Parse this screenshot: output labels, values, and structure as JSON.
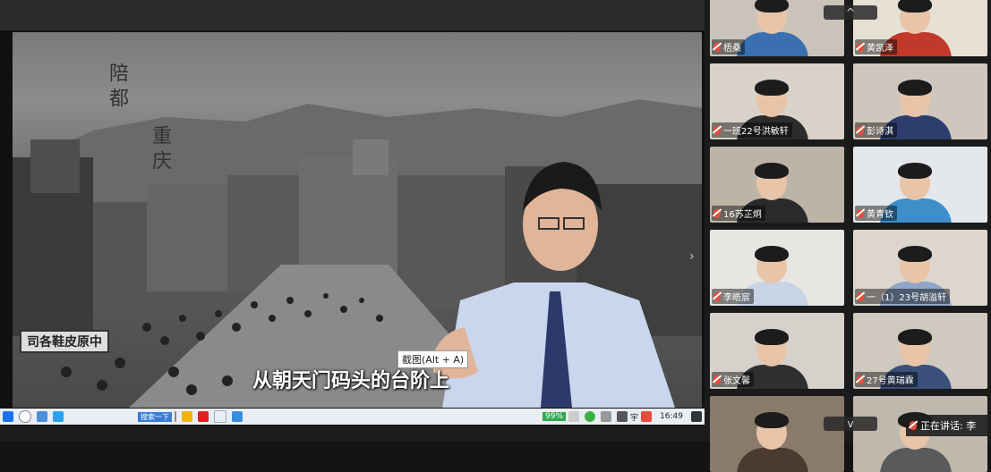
{
  "video": {
    "vertical_text_1": "陪都",
    "vertical_text_2": "重庆",
    "shop_sign": "司各鞋皮原中",
    "subtitle": "从朝天门码头的台阶上",
    "tooltip": "截图(Alt + A)"
  },
  "taskbar": {
    "search_hint": "搜索一下",
    "battery": "99%",
    "ime_char": "中",
    "ime_char2": "宇",
    "time": "16:49"
  },
  "participants": [
    {
      "name": "梧桑",
      "shirt": "#3a6fb0",
      "bg": "#c9c3ba"
    },
    {
      "name": "黄凯泽",
      "shirt": "#c0392b",
      "bg": "#e6e0d5"
    },
    {
      "name": "一班22号洪敏轩",
      "shirt": "#2c2c2c",
      "bg": "#d8d2c8"
    },
    {
      "name": "彭诗淇",
      "shirt": "#2d3e6e",
      "bg": "#cfc7bd"
    },
    {
      "name": "16苏芷炯",
      "shirt": "#2a2a2a",
      "bg": "#bdb4a8"
    },
    {
      "name": "黄青钦",
      "shirt": "#3d8ec9",
      "bg": "#e4e8ec"
    },
    {
      "name": "李皓宸",
      "shirt": "#c9d4e6",
      "bg": "#e8e6e2"
    },
    {
      "name": "一（1）23号胡溢轩",
      "shirt": "#8fa6c8",
      "bg": "#dcd6ce"
    },
    {
      "name": "张文馨",
      "shirt": "#2f2f2f",
      "bg": "#d6d1ca"
    },
    {
      "name": "27号黄瑞霖",
      "shirt": "#3a4f7a",
      "bg": "#cfc9bf"
    },
    {
      "name": "",
      "shirt": "#4a3a30",
      "bg": "#8a7a6a"
    },
    {
      "name": "",
      "shirt": "#5a5a5a",
      "bg": "#bfb8ad"
    }
  ],
  "controls": {
    "collapse_up": "^",
    "collapse_down": "v",
    "speaking_label": "正在讲话: 李"
  }
}
